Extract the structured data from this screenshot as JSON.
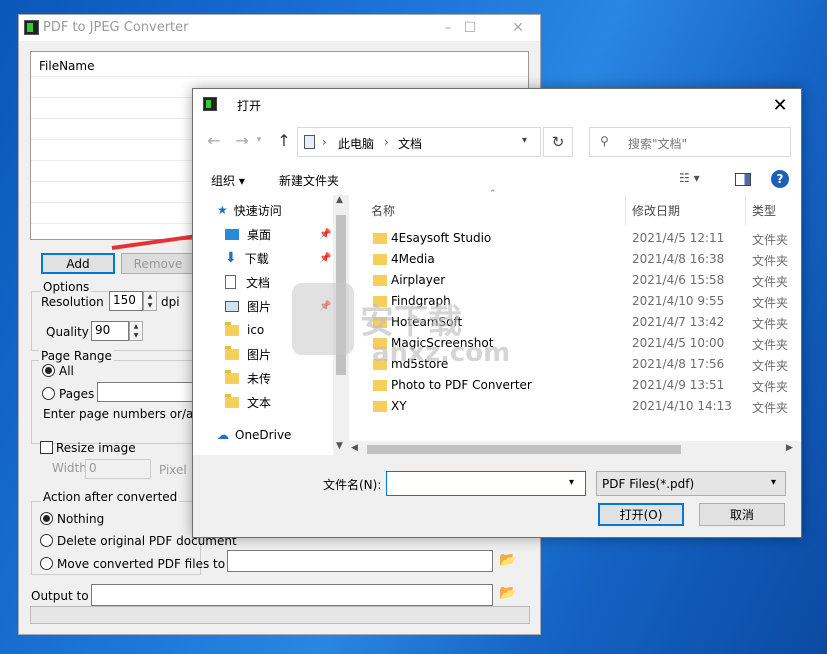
{
  "main": {
    "title": "PDF to JPEG Converter",
    "window_min": "–",
    "window_max": "☐",
    "window_close": "✕",
    "filelist_header": "FileName",
    "add_label": "Add",
    "remove_label": "Remove",
    "options_label": "Options",
    "resolution_label": "Resolution",
    "resolution_value": "150",
    "resolution_unit": "dpi",
    "quality_label": "Quality",
    "quality_value": "90",
    "page_range_label": "Page Range",
    "all_label": "All",
    "pages_label": "Pages",
    "page_hint": "Enter page numbers or/and pag",
    "resize_label": "Resize image",
    "width_label": "Width",
    "width_value": "0",
    "pixel_label": "Pixel",
    "action_label": "Action after converted",
    "nothing_label": "Nothing",
    "delete_label": "Delete original PDF document",
    "move_label": "Move converted PDF files to",
    "output_label": "Output to"
  },
  "dialog": {
    "title": "打开",
    "close": "✕",
    "back_icon": "←",
    "forward_icon": "→",
    "up_icon": "↑",
    "path": [
      "此电脑",
      "文档"
    ],
    "refresh_icon": "↻",
    "search_placeholder": "搜索\"文档\"",
    "organize_label": "组织 ▾",
    "new_folder_label": "新建文件夹",
    "help_icon": "?",
    "nav": {
      "quick_access": "快速访问",
      "items": [
        "桌面",
        "下载",
        "文档",
        "图片",
        "ico",
        "图片",
        "未传",
        "文本"
      ],
      "onedrive": "OneDrive"
    },
    "columns": {
      "name": "名称",
      "date": "修改日期",
      "type": "类型"
    },
    "files": [
      {
        "name": "4Esaysoft Studio",
        "date": "2021/4/5 12:11",
        "type": "文件夹"
      },
      {
        "name": "4Media",
        "date": "2021/4/8 16:38",
        "type": "文件夹"
      },
      {
        "name": "Airplayer",
        "date": "2021/4/6 15:58",
        "type": "文件夹"
      },
      {
        "name": "Findgraph",
        "date": "2021/4/10 9:55",
        "type": "文件夹"
      },
      {
        "name": "HoteamSoft",
        "date": "2021/4/7 13:42",
        "type": "文件夹"
      },
      {
        "name": "MagicScreenshot",
        "date": "2021/4/5 10:00",
        "type": "文件夹"
      },
      {
        "name": "md5store",
        "date": "2021/4/8 17:56",
        "type": "文件夹"
      },
      {
        "name": "Photo to PDF Converter",
        "date": "2021/4/9 13:51",
        "type": "文件夹"
      },
      {
        "name": "XY",
        "date": "2021/4/10 14:13",
        "type": "文件夹"
      }
    ],
    "filename_label": "文件名(N):",
    "filename_value": "",
    "filetype_value": "PDF Files(*.pdf)",
    "open_label": "打开(O)",
    "cancel_label": "取消"
  },
  "watermark": {
    "text": "安下载",
    "url": "anxz.com"
  }
}
